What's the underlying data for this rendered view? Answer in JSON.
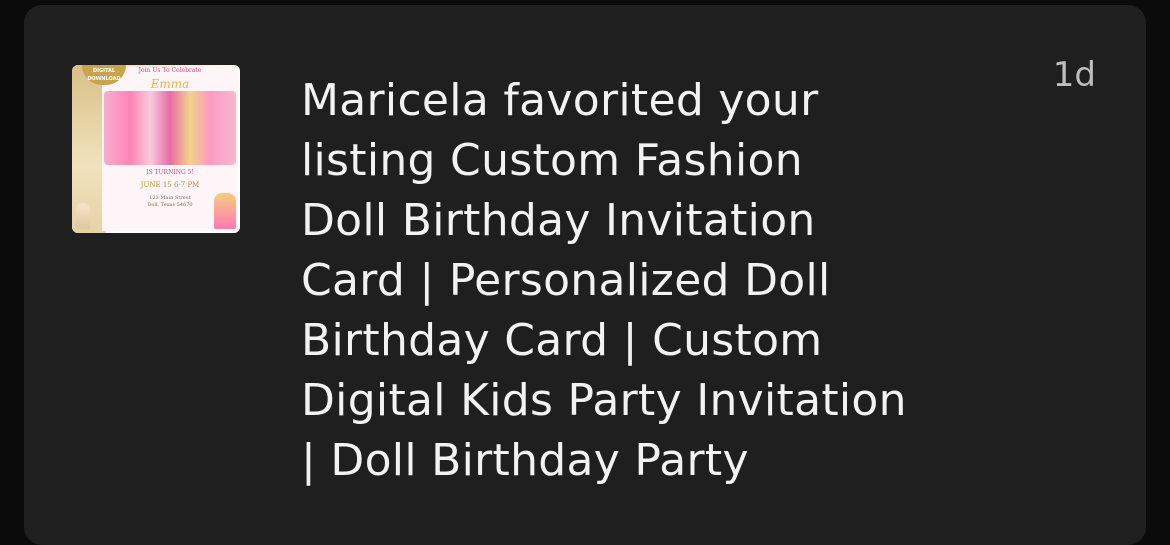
{
  "notification": {
    "time": "1d",
    "message_lines": [
      "Maricela favorited your",
      "listing Custom Fashion",
      "Doll Birthday Invitation",
      "Card | Personalized Doll",
      "Birthday Card | Custom",
      "Digital Kids Party Invitation",
      "| Doll Birthday Party"
    ],
    "thumbnail": {
      "badge": "DIGITAL DOWNLOAD",
      "join_text": "Join Us To Celebrate",
      "name": "Emma",
      "turning": "IS TURNING 5!",
      "date": "JUNE 15 6-7 PM",
      "address_line1": "123 Main Street",
      "address_line2": "Doll, Texas 54670"
    }
  }
}
